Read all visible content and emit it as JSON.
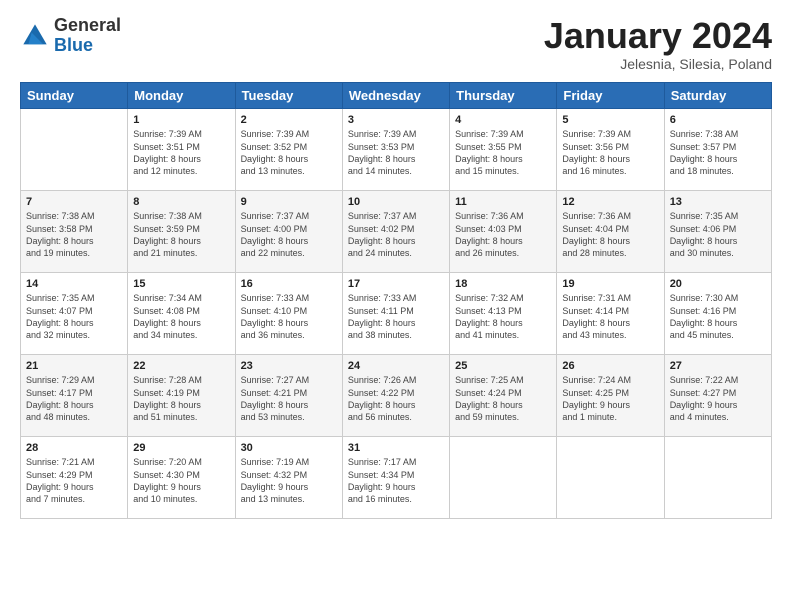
{
  "header": {
    "logo": {
      "line1": "General",
      "line2": "Blue"
    },
    "title": "January 2024",
    "subtitle": "Jelesnia, Silesia, Poland"
  },
  "weekdays": [
    "Sunday",
    "Monday",
    "Tuesday",
    "Wednesday",
    "Thursday",
    "Friday",
    "Saturday"
  ],
  "weeks": [
    {
      "shade": "white",
      "days": [
        {
          "num": "",
          "info": ""
        },
        {
          "num": "1",
          "info": "Sunrise: 7:39 AM\nSunset: 3:51 PM\nDaylight: 8 hours\nand 12 minutes."
        },
        {
          "num": "2",
          "info": "Sunrise: 7:39 AM\nSunset: 3:52 PM\nDaylight: 8 hours\nand 13 minutes."
        },
        {
          "num": "3",
          "info": "Sunrise: 7:39 AM\nSunset: 3:53 PM\nDaylight: 8 hours\nand 14 minutes."
        },
        {
          "num": "4",
          "info": "Sunrise: 7:39 AM\nSunset: 3:55 PM\nDaylight: 8 hours\nand 15 minutes."
        },
        {
          "num": "5",
          "info": "Sunrise: 7:39 AM\nSunset: 3:56 PM\nDaylight: 8 hours\nand 16 minutes."
        },
        {
          "num": "6",
          "info": "Sunrise: 7:38 AM\nSunset: 3:57 PM\nDaylight: 8 hours\nand 18 minutes."
        }
      ]
    },
    {
      "shade": "shade",
      "days": [
        {
          "num": "7",
          "info": "Sunrise: 7:38 AM\nSunset: 3:58 PM\nDaylight: 8 hours\nand 19 minutes."
        },
        {
          "num": "8",
          "info": "Sunrise: 7:38 AM\nSunset: 3:59 PM\nDaylight: 8 hours\nand 21 minutes."
        },
        {
          "num": "9",
          "info": "Sunrise: 7:37 AM\nSunset: 4:00 PM\nDaylight: 8 hours\nand 22 minutes."
        },
        {
          "num": "10",
          "info": "Sunrise: 7:37 AM\nSunset: 4:02 PM\nDaylight: 8 hours\nand 24 minutes."
        },
        {
          "num": "11",
          "info": "Sunrise: 7:36 AM\nSunset: 4:03 PM\nDaylight: 8 hours\nand 26 minutes."
        },
        {
          "num": "12",
          "info": "Sunrise: 7:36 AM\nSunset: 4:04 PM\nDaylight: 8 hours\nand 28 minutes."
        },
        {
          "num": "13",
          "info": "Sunrise: 7:35 AM\nSunset: 4:06 PM\nDaylight: 8 hours\nand 30 minutes."
        }
      ]
    },
    {
      "shade": "white",
      "days": [
        {
          "num": "14",
          "info": "Sunrise: 7:35 AM\nSunset: 4:07 PM\nDaylight: 8 hours\nand 32 minutes."
        },
        {
          "num": "15",
          "info": "Sunrise: 7:34 AM\nSunset: 4:08 PM\nDaylight: 8 hours\nand 34 minutes."
        },
        {
          "num": "16",
          "info": "Sunrise: 7:33 AM\nSunset: 4:10 PM\nDaylight: 8 hours\nand 36 minutes."
        },
        {
          "num": "17",
          "info": "Sunrise: 7:33 AM\nSunset: 4:11 PM\nDaylight: 8 hours\nand 38 minutes."
        },
        {
          "num": "18",
          "info": "Sunrise: 7:32 AM\nSunset: 4:13 PM\nDaylight: 8 hours\nand 41 minutes."
        },
        {
          "num": "19",
          "info": "Sunrise: 7:31 AM\nSunset: 4:14 PM\nDaylight: 8 hours\nand 43 minutes."
        },
        {
          "num": "20",
          "info": "Sunrise: 7:30 AM\nSunset: 4:16 PM\nDaylight: 8 hours\nand 45 minutes."
        }
      ]
    },
    {
      "shade": "shade",
      "days": [
        {
          "num": "21",
          "info": "Sunrise: 7:29 AM\nSunset: 4:17 PM\nDaylight: 8 hours\nand 48 minutes."
        },
        {
          "num": "22",
          "info": "Sunrise: 7:28 AM\nSunset: 4:19 PM\nDaylight: 8 hours\nand 51 minutes."
        },
        {
          "num": "23",
          "info": "Sunrise: 7:27 AM\nSunset: 4:21 PM\nDaylight: 8 hours\nand 53 minutes."
        },
        {
          "num": "24",
          "info": "Sunrise: 7:26 AM\nSunset: 4:22 PM\nDaylight: 8 hours\nand 56 minutes."
        },
        {
          "num": "25",
          "info": "Sunrise: 7:25 AM\nSunset: 4:24 PM\nDaylight: 8 hours\nand 59 minutes."
        },
        {
          "num": "26",
          "info": "Sunrise: 7:24 AM\nSunset: 4:25 PM\nDaylight: 9 hours\nand 1 minute."
        },
        {
          "num": "27",
          "info": "Sunrise: 7:22 AM\nSunset: 4:27 PM\nDaylight: 9 hours\nand 4 minutes."
        }
      ]
    },
    {
      "shade": "white",
      "days": [
        {
          "num": "28",
          "info": "Sunrise: 7:21 AM\nSunset: 4:29 PM\nDaylight: 9 hours\nand 7 minutes."
        },
        {
          "num": "29",
          "info": "Sunrise: 7:20 AM\nSunset: 4:30 PM\nDaylight: 9 hours\nand 10 minutes."
        },
        {
          "num": "30",
          "info": "Sunrise: 7:19 AM\nSunset: 4:32 PM\nDaylight: 9 hours\nand 13 minutes."
        },
        {
          "num": "31",
          "info": "Sunrise: 7:17 AM\nSunset: 4:34 PM\nDaylight: 9 hours\nand 16 minutes."
        },
        {
          "num": "",
          "info": ""
        },
        {
          "num": "",
          "info": ""
        },
        {
          "num": "",
          "info": ""
        }
      ]
    }
  ]
}
